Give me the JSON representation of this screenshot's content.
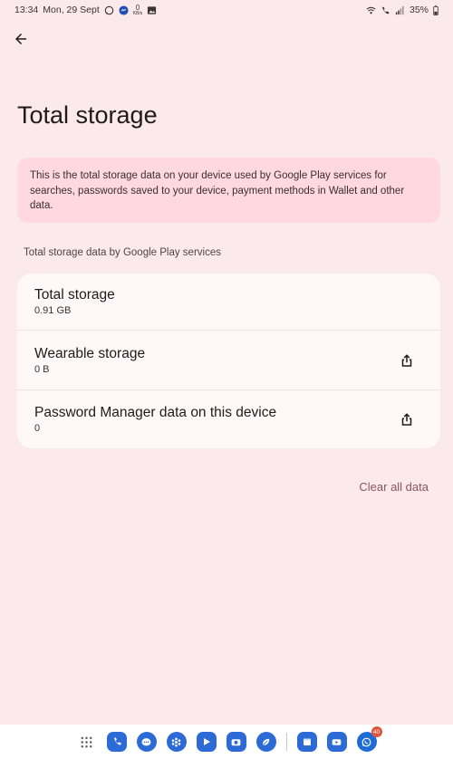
{
  "status_bar": {
    "time": "13:34",
    "date": "Mon, 29 Sept",
    "notif_counter": "0",
    "notif_speed": "KB/s",
    "battery": "35%"
  },
  "header": {
    "title": "Total storage"
  },
  "banner": {
    "text": "This is the total storage data on your device used by Google Play services for searches, passwords saved to your device, payment methods in Wallet and other data."
  },
  "section": {
    "label": "Total storage data by Google Play services"
  },
  "rows": [
    {
      "title": "Total storage",
      "value": "0.91 GB"
    },
    {
      "title": "Wearable storage",
      "value": "0 B"
    },
    {
      "title": "Password Manager data on this device",
      "value": "0"
    }
  ],
  "actions": {
    "clear_all": "Clear all data"
  },
  "dock": {
    "badge": "40"
  },
  "colors": {
    "background": "#fbe9ec",
    "banner": "#ffd9df",
    "card": "#fff8f8",
    "accent": "#8a5563"
  }
}
